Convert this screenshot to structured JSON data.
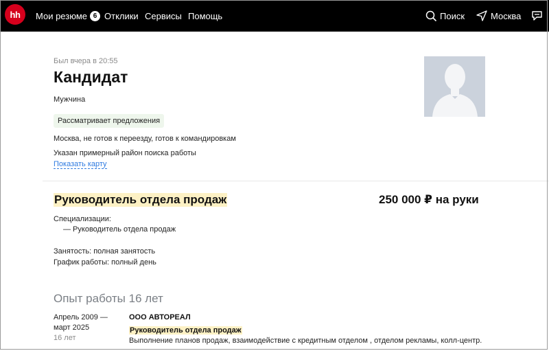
{
  "header": {
    "logo": "hh",
    "nav": {
      "resumes": "Мои резюме",
      "resumes_count": "6",
      "responses": "Отклики",
      "services": "Сервисы",
      "help": "Помощь",
      "search": "Поиск",
      "city": "Москва"
    }
  },
  "profile": {
    "last_seen": "Был вчера в 20:55",
    "name": "Кандидат",
    "gender": "Мужчина",
    "status": "Рассматривает предложения",
    "location": "Москва, не готов к переезду, готов к командировкам",
    "district_note": "Указан примерный район поиска работы",
    "show_map": "Показать карту"
  },
  "position": {
    "title": "Руководитель отдела продаж",
    "salary": "250 000 ₽ на руки",
    "specializations_label": "Специализации:",
    "specialization": "— Руководитель отдела продаж",
    "employment": "Занятость: полная занятость",
    "schedule": "График работы: полный день"
  },
  "experience": {
    "title": "Опыт работы 16 лет",
    "items": [
      {
        "period_start": "Апрель 2009 —",
        "period_end": "март 2025",
        "duration": "16 лет",
        "company": "ООО АВТОРЕАЛ",
        "role": "Руководитель отдела продаж",
        "description": "Выполнение планов продаж, взаимодействие с кредитным отделом , отделом рекламы, колл-центр."
      }
    ]
  },
  "icons": {
    "search": "search-icon",
    "location": "location-arrow-icon",
    "chat": "chat-icon"
  },
  "colors": {
    "brand": "#d6001c",
    "highlight": "#fdf1c4",
    "link": "#2e7ae0",
    "status_tag": "#eef6ec"
  }
}
